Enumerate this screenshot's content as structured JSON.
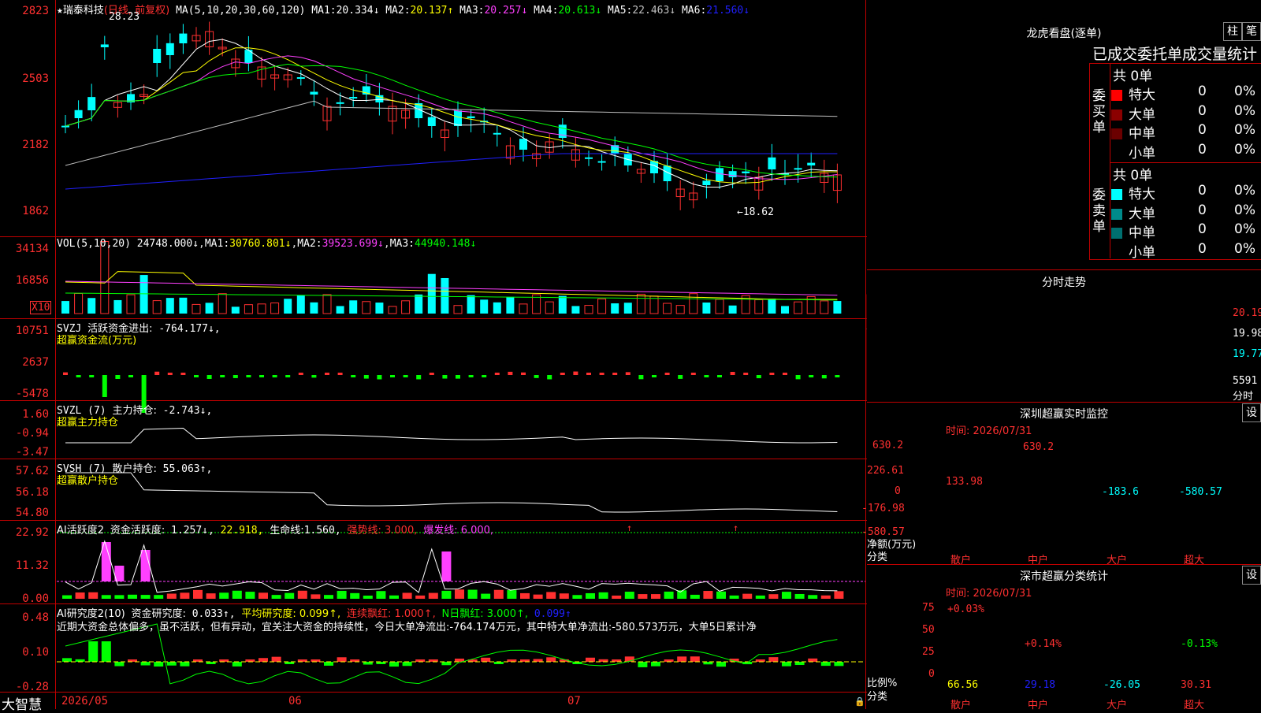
{
  "stock": {
    "name_prefix": "★",
    "name": "瑞泰科技",
    "mode": "(日线, 前复权)"
  },
  "ma_line": {
    "label": "MA(5,10,20,30,60,120)",
    "items": [
      {
        "label": "MA1:",
        "value": "20.334↓",
        "color": "#ffffff"
      },
      {
        "label": "MA2:",
        "value": "20.137↑",
        "color": "#ffff00"
      },
      {
        "label": "MA3:",
        "value": "20.257↓",
        "color": "#ff40ff"
      },
      {
        "label": "MA4:",
        "value": "20.613↓",
        "color": "#00ff00"
      },
      {
        "label": "MA5:",
        "value": "22.463↓",
        "color": "#c0c0c0"
      },
      {
        "label": "MA6:",
        "value": "21.560↓",
        "color": "#2020ff"
      }
    ]
  },
  "price_axis": [
    "2823",
    "2503",
    "2182",
    "1862"
  ],
  "price_marks": {
    "high": "28.23",
    "low": "←18.62"
  },
  "vol_line": {
    "label": "VOL(5,10,20)",
    "value": "24748.000↓",
    "ma1_label": "MA1:",
    "ma1": "30760.801↓",
    "ma2_label": "MA2:",
    "ma2": "39523.699↓",
    "ma3_label": "MA3:",
    "ma3": "44940.148↓"
  },
  "vol_axis": [
    "34134",
    "16856"
  ],
  "vol_unit": "X10",
  "svzj": {
    "label": "SVZJ",
    "desc": "活跃资金进出:",
    "value": "-764.177↓,",
    "sub": "超赢资金流(万元)",
    "axis": [
      "10751",
      "2637",
      "-5478"
    ]
  },
  "svzl": {
    "label": "SVZL (7)",
    "desc": "主力持仓:",
    "value": "-2.743↓,",
    "sub": "超赢主力持仓",
    "axis": [
      "1.60",
      "-0.94",
      "-3.47"
    ]
  },
  "svsh": {
    "label": "SVSH (7)",
    "desc": "散户持仓:",
    "value": "55.063↑,",
    "sub": "超赢散户持仓",
    "axis": [
      "57.62",
      "56.18",
      "54.80"
    ]
  },
  "ai1": {
    "label": "AI活跃度2",
    "desc": "资金活跃度:",
    "value": "1.257↓,",
    "v2": "22.918,",
    "life_label": "生命线:",
    "life": "1.560,",
    "strong": "强势线: 3.000,",
    "burst": "爆发线: 6.000,",
    "axis": [
      "22.92",
      "11.32",
      "0.00"
    ]
  },
  "ai2": {
    "label": "AI研究度2(10)",
    "desc": "资金研究度:",
    "value": "0.033↑,",
    "avg": "平均研究度: 0.099↑,",
    "red_cont": "连续飘红: 1.000↑,",
    "n_red": "N日飘红: 3.000↑,",
    "last": "0.099↑",
    "text": "近期大资金总体偏多，虽不活跃，但有异动，宜关注大资金的持续性，今日大单净流出:-764.174万元，其中特大单净流出:-580.573万元，大单5日累计净",
    "axis": [
      "0.48",
      "0.10",
      "-0.28"
    ]
  },
  "date_axis": [
    "2026/05",
    "06",
    "07"
  ],
  "brand": "大智慧",
  "right": {
    "lhb_title": "龙虎看盘(逐单)",
    "btn_zhu": "柱",
    "btn_bi": "笔",
    "stat_title": "已成交委托单成交量统计",
    "buy_label": "委买单",
    "sell_label": "委卖单",
    "buy_total": "共 0单",
    "sell_total": "共 0单",
    "buy_rows": [
      {
        "name": "特大",
        "val": "0",
        "pct": "0%",
        "color": "#ff0000"
      },
      {
        "name": "大单",
        "val": "0",
        "pct": "0%",
        "color": "#8b0000"
      },
      {
        "name": "中单",
        "val": "0",
        "pct": "0%",
        "color": "#6b0000"
      },
      {
        "name": "小单",
        "val": "0",
        "pct": "0%",
        "color": "#000000"
      }
    ],
    "sell_rows": [
      {
        "name": "特大",
        "val": "0",
        "pct": "0%",
        "color": "#00ffff"
      },
      {
        "name": "大单",
        "val": "0",
        "pct": "0%",
        "color": "#008b8b"
      },
      {
        "name": "中单",
        "val": "0",
        "pct": "0%",
        "color": "#007070"
      },
      {
        "name": "小单",
        "val": "0",
        "pct": "0%",
        "color": "#000000"
      }
    ],
    "fenshi_title": "分时走势",
    "fenshi_axis": [
      "20.19",
      "19.98",
      "19.77",
      "5591",
      "分时"
    ],
    "monitor_title": "深圳超赢实时监控",
    "btn_set": "设",
    "monitor_time": "时间: 2026/07/31",
    "monitor_axis": [
      "630.2",
      "226.61",
      "0",
      "-176.98",
      "-580.57"
    ],
    "monitor_ylabel": "净额(万元)",
    "monitor_xlabel": "分类",
    "monitor_bars": [
      {
        "cat": "散户",
        "value": "133.98"
      },
      {
        "cat": "中户",
        "value": "630.2"
      },
      {
        "cat": "大户",
        "value": "-183.6"
      },
      {
        "cat": "超大",
        "value": "-580.57"
      }
    ],
    "class_title": "深市超赢分类统计",
    "class_time": "时间: 2026/07/31",
    "class_axis": [
      "75",
      "50",
      "25",
      "0"
    ],
    "class_ylabel": "比例%",
    "class_xlabel": "分类",
    "class_bars": [
      {
        "cat": "散户",
        "top": "+0.03%",
        "bottom": "66.56"
      },
      {
        "cat": "中户",
        "top": "+0.14%",
        "bottom": "29.18"
      },
      {
        "cat": "大户",
        "top": "",
        "bottom": "-26.05"
      },
      {
        "cat": "超大",
        "top": "-0.13%",
        "bottom": "30.31"
      }
    ]
  }
}
